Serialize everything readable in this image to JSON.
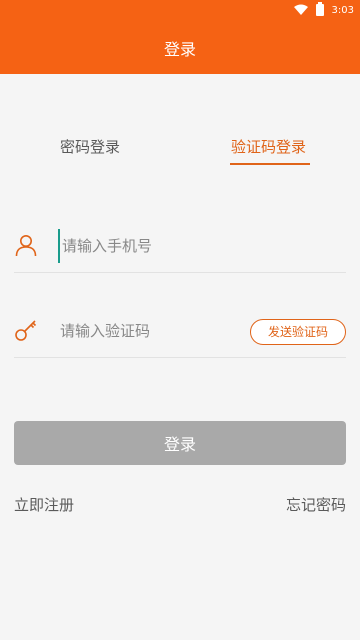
{
  "status_bar": {
    "time": "3:03"
  },
  "header": {
    "title": "登录"
  },
  "tabs": [
    {
      "label": "密码登录",
      "active": false
    },
    {
      "label": "验证码登录",
      "active": true
    }
  ],
  "form": {
    "phone": {
      "placeholder": "请输入手机号",
      "value": ""
    },
    "code": {
      "placeholder": "请输入验证码",
      "value": ""
    },
    "send_code_label": "发送验证码",
    "submit_label": "登录"
  },
  "links": {
    "register": "立即注册",
    "forgot_password": "忘记密码"
  },
  "colors": {
    "brand": "#f56214",
    "accent": "#e06419",
    "button_disabled": "#a9a9a9"
  }
}
